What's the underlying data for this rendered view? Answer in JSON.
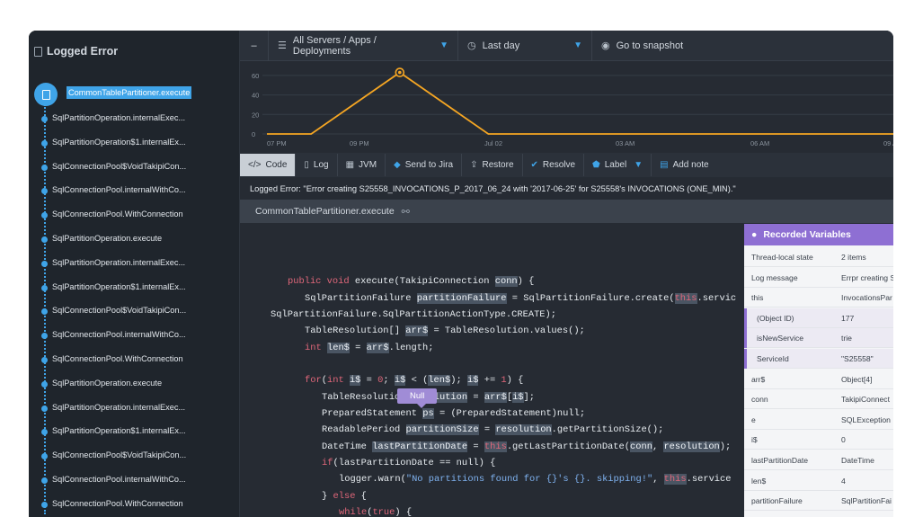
{
  "left_panel": {
    "title": "Logged Error",
    "selected_frame": "CommonTablePartitioner.execute",
    "frames": [
      "SqlPartitionOperation.internalExec...",
      "SqlPartitionOperation$1.internalEx...",
      "SqlConnectionPool$VoidTakipiCon...",
      "SqlConnectionPool.internalWithCo...",
      "SqlConnectionPool.WithConnection",
      "SqlPartitionOperation.execute",
      "SqlPartitionOperation.internalExec...",
      "SqlPartitionOperation$1.internalEx...",
      "SqlConnectionPool$VoidTakipiCon...",
      "SqlConnectionPool.internalWithCo...",
      "SqlConnectionPool.WithConnection",
      "SqlPartitionOperation.execute",
      "SqlPartitionOperation.internalExec...",
      "SqlPartitionOperation$1.internalEx...",
      "SqlConnectionPool$VoidTakipiCon...",
      "SqlConnectionPool.internalWithCo...",
      "SqlConnectionPool.WithConnection"
    ]
  },
  "topbar": {
    "collapse_label": "–",
    "servers_label": "All Servers / Apps / Deployments",
    "time_label": "Last day",
    "snapshot_label": "Go to snapshot"
  },
  "chart_data": {
    "type": "line",
    "y_ticks": [
      "60",
      "40",
      "20",
      "0"
    ],
    "x_ticks": [
      "07 PM",
      "09 PM",
      "Jul 02",
      "03 AM",
      "06 AM",
      "09 A"
    ],
    "ylim": [
      0,
      70
    ],
    "series": [
      {
        "values": [
          {
            "x": "07 PM",
            "y": 0
          },
          {
            "x": "08 PM",
            "y": 0
          },
          {
            "x": "10 PM",
            "y": 63
          },
          {
            "x": "00 AM",
            "y": 0
          },
          {
            "x": "09 AM",
            "y": 0
          }
        ]
      }
    ],
    "grid": true,
    "color": "#f5a623"
  },
  "toolbar": {
    "code": "Code",
    "log": "Log",
    "jvm": "JVM",
    "jira": "Send to Jira",
    "restore": "Restore",
    "resolve": "Resolve",
    "label": "Label",
    "add_note": "Add note"
  },
  "error_message": "Logged Error: \"Error creating S25558_INVOCATIONS_P_2017_06_24 with '2017-06-25' for S25558's INVOCATIONS (ONE_MIN).\"",
  "file_bar": {
    "method": "CommonTablePartitioner.execute",
    "link_icon": "link-icon"
  },
  "tooltip": "Null",
  "variables": {
    "title": "Recorded Variables",
    "rows": [
      {
        "k": "Thread-local state",
        "v": "2 items"
      },
      {
        "k": "Log message",
        "v": "Errpr creating S"
      },
      {
        "k": "this",
        "v": "InvocationsPar"
      },
      {
        "k": "(Object ID)",
        "v": "177"
      },
      {
        "k": "isNewService",
        "v": "trie"
      },
      {
        "k": "ServiceId",
        "v": "\"S25558\""
      },
      {
        "k": "arr$",
        "v": "Object[4]"
      },
      {
        "k": "conn",
        "v": "TakipiConnect"
      },
      {
        "k": "e",
        "v": "SQLException"
      },
      {
        "k": "i$",
        "v": "0"
      },
      {
        "k": "lastPartitionDate",
        "v": "DateTime"
      },
      {
        "k": "len$",
        "v": "4"
      },
      {
        "k": "partitionFailure",
        "v": "SqlPartitionFai"
      }
    ]
  },
  "colors": {
    "accent_blue": "#3fa4e8",
    "accent_purple": "#8e6fd3",
    "chart_orange": "#f5a623",
    "keyword": "#e0677a"
  }
}
